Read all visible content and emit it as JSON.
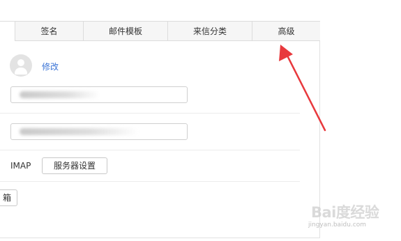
{
  "tabs": [
    {
      "label": "签名"
    },
    {
      "label": "邮件模板"
    },
    {
      "label": "来信分类"
    },
    {
      "label": "高级"
    }
  ],
  "profile": {
    "edit_link": "修改"
  },
  "fields": [
    {
      "value": "████████"
    },
    {
      "value": "██████@█████"
    }
  ],
  "imap": {
    "label": "IMAP",
    "server_button": "服务器设置"
  },
  "partial_button": {
    "label": "箱"
  },
  "watermark": {
    "brand": "Bai度经验",
    "url": "jingyan.baidu.com"
  },
  "colors": {
    "accent": "#3b74d6",
    "annotation": "#e8393d"
  }
}
